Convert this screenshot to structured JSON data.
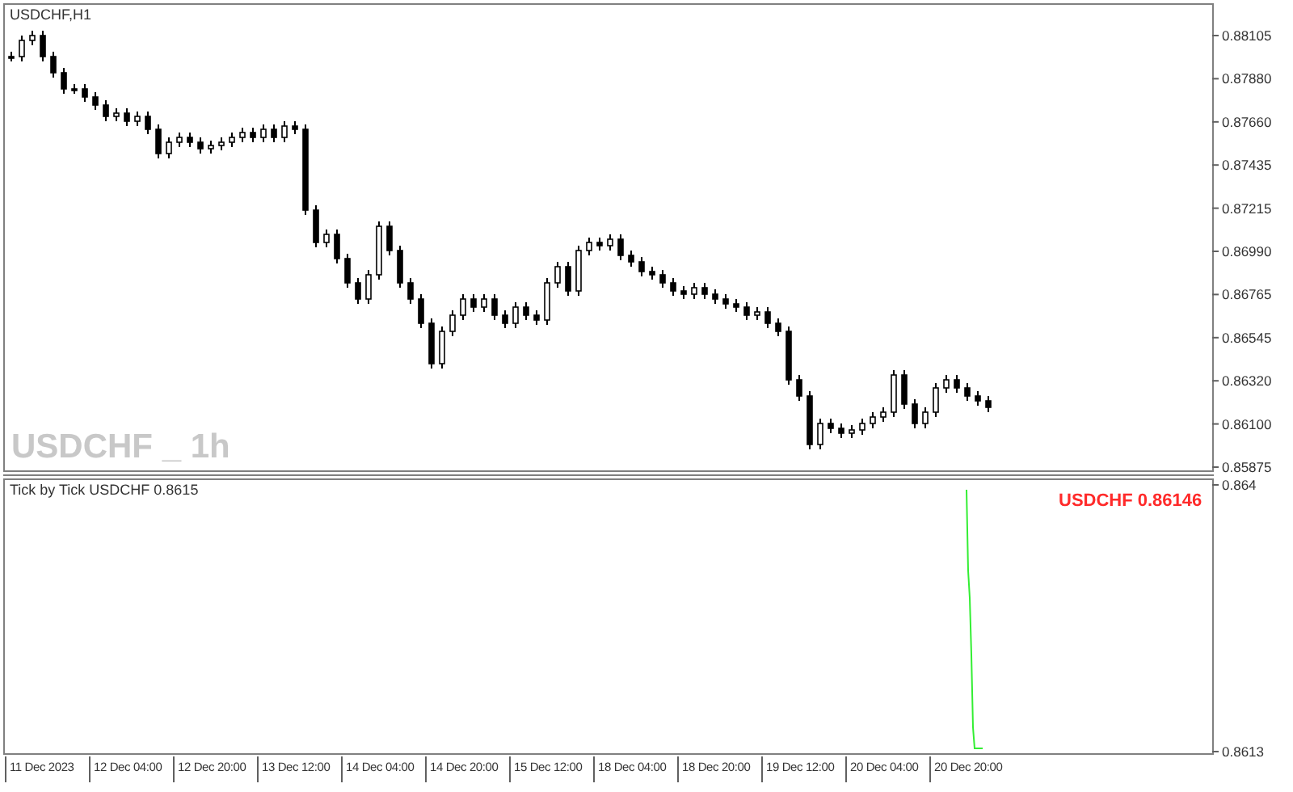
{
  "main_chart": {
    "title": "USDCHF,H1",
    "symbol_label": "USDCHF _ 1h",
    "price_axis": [
      "0.88105",
      "0.87880",
      "0.87660",
      "0.87435",
      "0.87215",
      "0.86990",
      "0.86765",
      "0.86545",
      "0.86320",
      "0.86100",
      "0.85875"
    ]
  },
  "tick_window": {
    "title": "Tick by Tick USDCHF 0.8615",
    "price_label": "USDCHF 0.86146",
    "price_axis": [
      "0.864",
      "0.8613"
    ]
  },
  "time_axis": {
    "labels": [
      "11 Dec 2023",
      "12 Dec 04:00",
      "12 Dec 20:00",
      "13 Dec 12:00",
      "14 Dec 04:00",
      "14 Dec 20:00",
      "15 Dec 12:00",
      "18 Dec 04:00",
      "18 Dec 20:00",
      "19 Dec 12:00",
      "20 Dec 04:00",
      "20 Dec 20:00"
    ]
  }
}
